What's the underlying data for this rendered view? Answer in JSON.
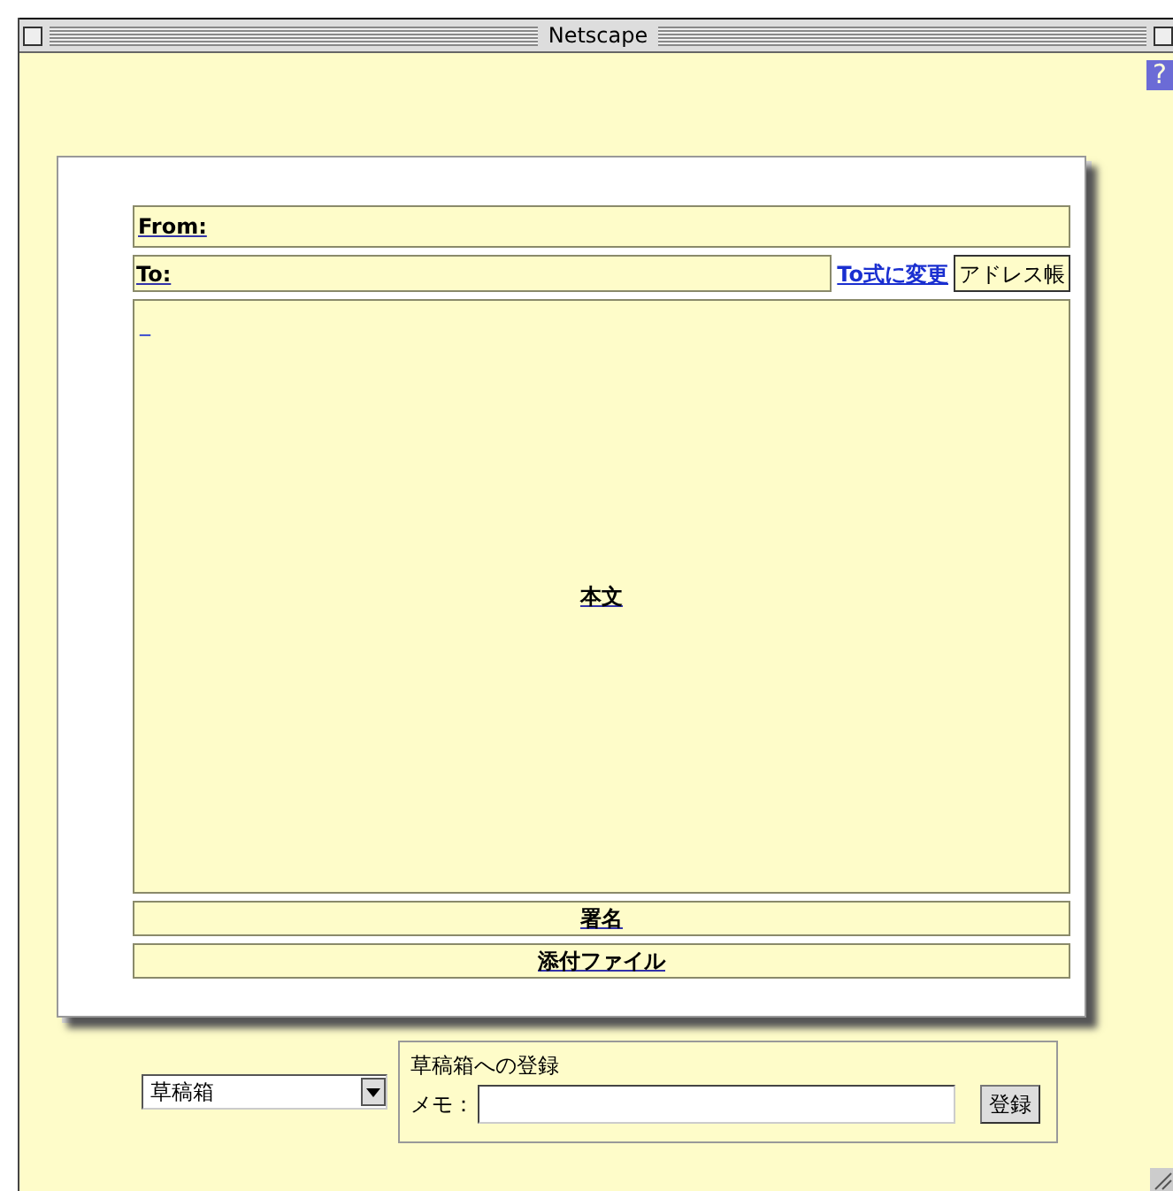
{
  "window": {
    "title": "Netscape"
  },
  "help_button": {
    "label": "?"
  },
  "compose": {
    "from_label": "From:",
    "to_label": "To:",
    "to_switch_link": "To式に変更",
    "address_book_button": "アドレス帳",
    "body_cursor": "_",
    "body_label": "本文",
    "signature_label": "署名",
    "attachment_label": "添付ファイル"
  },
  "folder_select": {
    "value": "草稿箱"
  },
  "draft_register": {
    "legend": "草稿箱への登録",
    "memo_label": "メモ：",
    "register_button": "登録"
  }
}
